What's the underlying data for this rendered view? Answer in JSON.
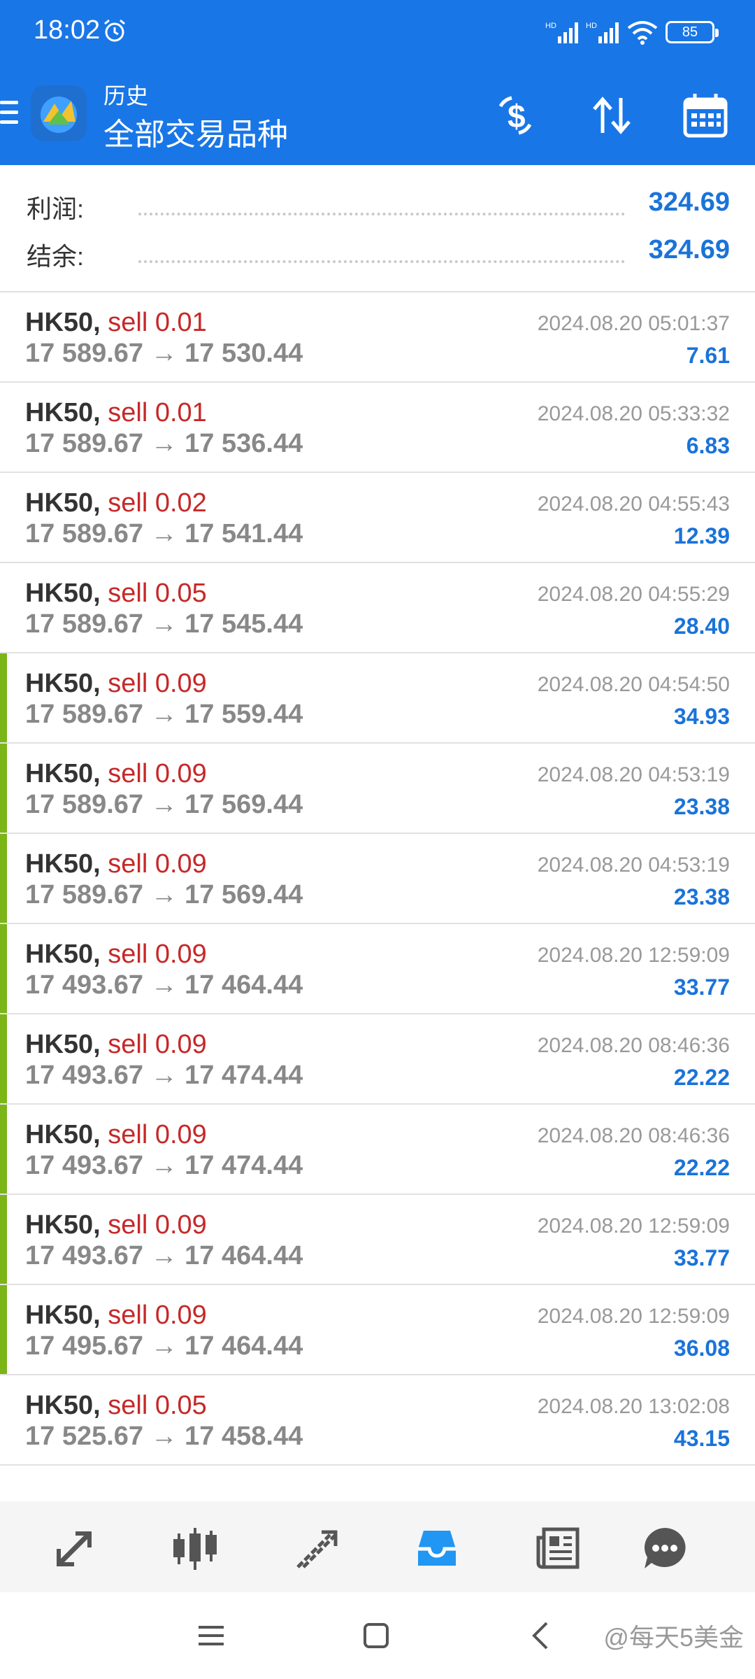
{
  "status_bar": {
    "time": "18:02",
    "battery": "85",
    "alarm_icon": "alarm-clock-icon"
  },
  "app_bar": {
    "subtitle": "历史",
    "title": "全部交易品种"
  },
  "summary": {
    "profit_label": "利润:",
    "profit_value": "324.69",
    "balance_label": "结余:",
    "balance_value": "324.69"
  },
  "deals": [
    {
      "symbol": "HK50,",
      "side": "sell 0.01",
      "prices": "17 589.67 → 17 530.44",
      "date": "2024.08.20 05:01:37",
      "profit": "7.61",
      "highlight": false
    },
    {
      "symbol": "HK50,",
      "side": "sell 0.01",
      "prices": "17 589.67 → 17 536.44",
      "date": "2024.08.20 05:33:32",
      "profit": "6.83",
      "highlight": false
    },
    {
      "symbol": "HK50,",
      "side": "sell 0.02",
      "prices": "17 589.67 → 17 541.44",
      "date": "2024.08.20 04:55:43",
      "profit": "12.39",
      "highlight": false
    },
    {
      "symbol": "HK50,",
      "side": "sell 0.05",
      "prices": "17 589.67 → 17 545.44",
      "date": "2024.08.20 04:55:29",
      "profit": "28.40",
      "highlight": false
    },
    {
      "symbol": "HK50,",
      "side": "sell 0.09",
      "prices": "17 589.67 → 17 559.44",
      "date": "2024.08.20 04:54:50",
      "profit": "34.93",
      "highlight": true
    },
    {
      "symbol": "HK50,",
      "side": "sell 0.09",
      "prices": "17 589.67 → 17 569.44",
      "date": "2024.08.20 04:53:19",
      "profit": "23.38",
      "highlight": true
    },
    {
      "symbol": "HK50,",
      "side": "sell 0.09",
      "prices": "17 589.67 → 17 569.44",
      "date": "2024.08.20 04:53:19",
      "profit": "23.38",
      "highlight": true
    },
    {
      "symbol": "HK50,",
      "side": "sell 0.09",
      "prices": "17 493.67 → 17 464.44",
      "date": "2024.08.20 12:59:09",
      "profit": "33.77",
      "highlight": true
    },
    {
      "symbol": "HK50,",
      "side": "sell 0.09",
      "prices": "17 493.67 → 17 474.44",
      "date": "2024.08.20 08:46:36",
      "profit": "22.22",
      "highlight": true
    },
    {
      "symbol": "HK50,",
      "side": "sell 0.09",
      "prices": "17 493.67 → 17 474.44",
      "date": "2024.08.20 08:46:36",
      "profit": "22.22",
      "highlight": true
    },
    {
      "symbol": "HK50,",
      "side": "sell 0.09",
      "prices": "17 493.67 → 17 464.44",
      "date": "2024.08.20 12:59:09",
      "profit": "33.77",
      "highlight": true
    },
    {
      "symbol": "HK50,",
      "side": "sell 0.09",
      "prices": "17 495.67 → 17 464.44",
      "date": "2024.08.20 12:59:09",
      "profit": "36.08",
      "highlight": true
    },
    {
      "symbol": "HK50,",
      "side": "sell 0.05",
      "prices": "17 525.67 → 17 458.44",
      "date": "2024.08.20 13:02:08",
      "profit": "43.15",
      "highlight": false
    }
  ],
  "colors": {
    "primary": "#1976e6",
    "sell": "#c62828",
    "profit": "#1a73d9",
    "highlight_bar": "#7cb518",
    "active_nav": "#2196f3"
  },
  "bottom_nav": [
    {
      "icon": "quotes-icon",
      "active": false
    },
    {
      "icon": "candlestick-chart-icon",
      "active": false
    },
    {
      "icon": "trade-icon",
      "active": false
    },
    {
      "icon": "history-inbox-icon",
      "active": true
    },
    {
      "icon": "news-icon",
      "active": false
    },
    {
      "icon": "chat-icon",
      "active": false
    }
  ],
  "watermark": "@每天5美金"
}
